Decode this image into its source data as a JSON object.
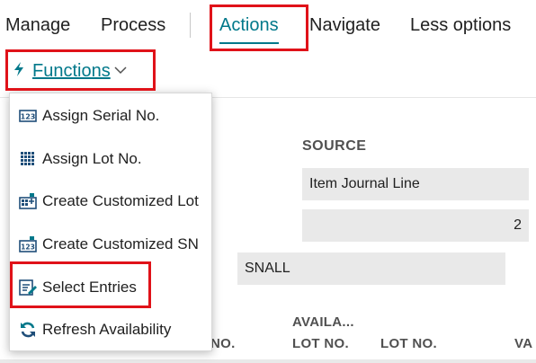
{
  "topbar": {
    "tabs": [
      {
        "label": "Manage"
      },
      {
        "label": "Process"
      },
      {
        "label": "Actions"
      },
      {
        "label": "Navigate"
      },
      {
        "label": "Less options"
      }
    ]
  },
  "subbar": {
    "functions_label": "Functions"
  },
  "menu": {
    "items": [
      {
        "label": "Assign Serial No.",
        "icon": "serial-number-icon"
      },
      {
        "label": "Assign Lot No.",
        "icon": "lot-number-icon"
      },
      {
        "label": "Create Customized Lot",
        "icon": "create-lot-icon"
      },
      {
        "label": "Create Customized SN",
        "icon": "create-sn-icon"
      },
      {
        "label": "Select Entries",
        "icon": "select-entries-icon"
      },
      {
        "label": "Refresh Availability",
        "icon": "refresh-icon"
      }
    ]
  },
  "form": {
    "source_label": "SOURCE",
    "source_value": "Item Journal Line",
    "quantity_value": "2",
    "code_value": "SNALL"
  },
  "columns": {
    "serial_no_partial": "NO.",
    "availability_line1": "AVAILA...",
    "availability_line2": "LOT NO.",
    "lot_no": "LOT NO.",
    "partial_right": "VA"
  },
  "colors": {
    "accent": "#00788a",
    "highlight": "#e01219",
    "field_bg": "#e9e9e9"
  }
}
